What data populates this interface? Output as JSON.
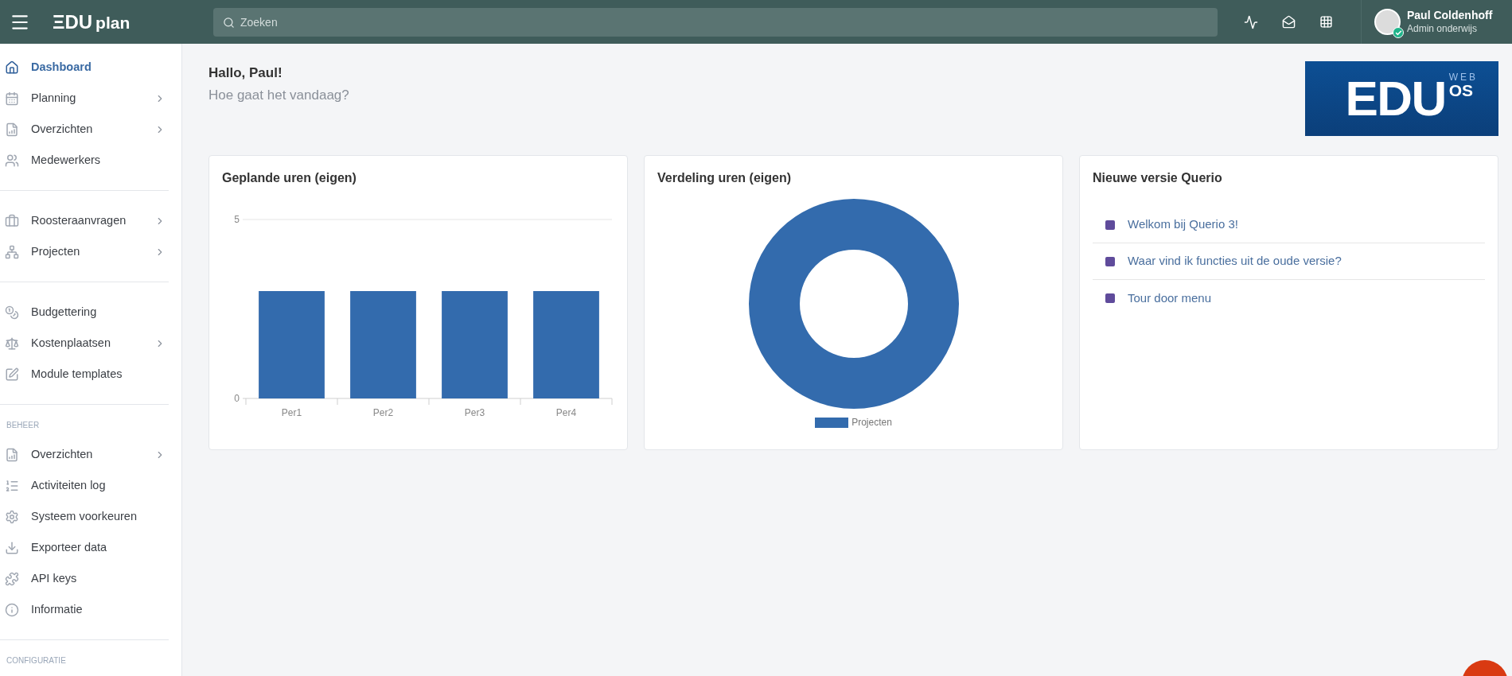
{
  "topbar": {
    "logo": {
      "mark": "ΞDU",
      "word": "plan"
    },
    "search": {
      "placeholder": "Zoeken"
    },
    "user": {
      "name": "Paul Coldenhoff",
      "role": "Admin onderwijs",
      "online": true
    }
  },
  "sidebar": {
    "groups": [
      {
        "items": [
          {
            "label": "Dashboard",
            "selected": true,
            "submenu": false
          },
          {
            "label": "Planning",
            "selected": false,
            "submenu": true
          },
          {
            "label": "Overzichten",
            "selected": false,
            "submenu": true
          },
          {
            "label": "Medewerkers",
            "selected": false,
            "submenu": false
          }
        ]
      },
      {
        "items": [
          {
            "label": "Roosteraanvragen",
            "selected": false,
            "submenu": true
          },
          {
            "label": "Projecten",
            "selected": false,
            "submenu": true
          }
        ]
      },
      {
        "items": [
          {
            "label": "Budgettering",
            "selected": false,
            "submenu": false
          },
          {
            "label": "Kostenplaatsen",
            "selected": false,
            "submenu": true
          },
          {
            "label": "Module templates",
            "selected": false,
            "submenu": false
          }
        ]
      },
      {
        "heading": "BEHEER",
        "items": [
          {
            "label": "Overzichten",
            "selected": false,
            "submenu": true
          },
          {
            "label": "Activiteiten log",
            "selected": false,
            "submenu": false
          },
          {
            "label": "Systeem voorkeuren",
            "selected": false,
            "submenu": false
          },
          {
            "label": "Exporteer data",
            "selected": false,
            "submenu": false
          },
          {
            "label": "API keys",
            "selected": false,
            "submenu": false
          },
          {
            "label": "Informatie",
            "selected": false,
            "submenu": false
          }
        ]
      },
      {
        "heading": "CONFIGURATIE"
      }
    ]
  },
  "greeting": {
    "title": "Hallo, Paul!",
    "subtitle": "Hoe gaat het vandaag?"
  },
  "brand_logo": {
    "mark": "EDU",
    "sup": "WEB",
    "sub": "OS"
  },
  "cards": [
    {
      "kind": "chart",
      "title": "Geplande uren (eigen)",
      "chart_data": {
        "type": "bar",
        "categories": [
          "Per1",
          "Per2",
          "Per3",
          "Per4"
        ],
        "series": [
          {
            "color": "#336bad",
            "values": [
              3,
              3,
              3,
              3
            ]
          }
        ],
        "ylim": [
          0,
          5
        ],
        "yticks": [
          0,
          5
        ]
      }
    },
    {
      "kind": "chart",
      "title": "Verdeling uren (eigen)",
      "chart_data": {
        "type": "pie",
        "categories": [
          "Projecten"
        ],
        "series": [
          {
            "color": "#336bad",
            "values": [
              1
            ]
          }
        ]
      }
    },
    {
      "kind": "links",
      "title": "Nieuwe versie Querio",
      "links": [
        {
          "label": "Welkom bij Querio 3!",
          "color": "#5f4b9b"
        },
        {
          "label": "Waar vind ik functies uit de oude versie?",
          "color": "#5f4b9b"
        },
        {
          "label": "Tour door menu",
          "color": "#5f4b9b"
        }
      ]
    }
  ]
}
